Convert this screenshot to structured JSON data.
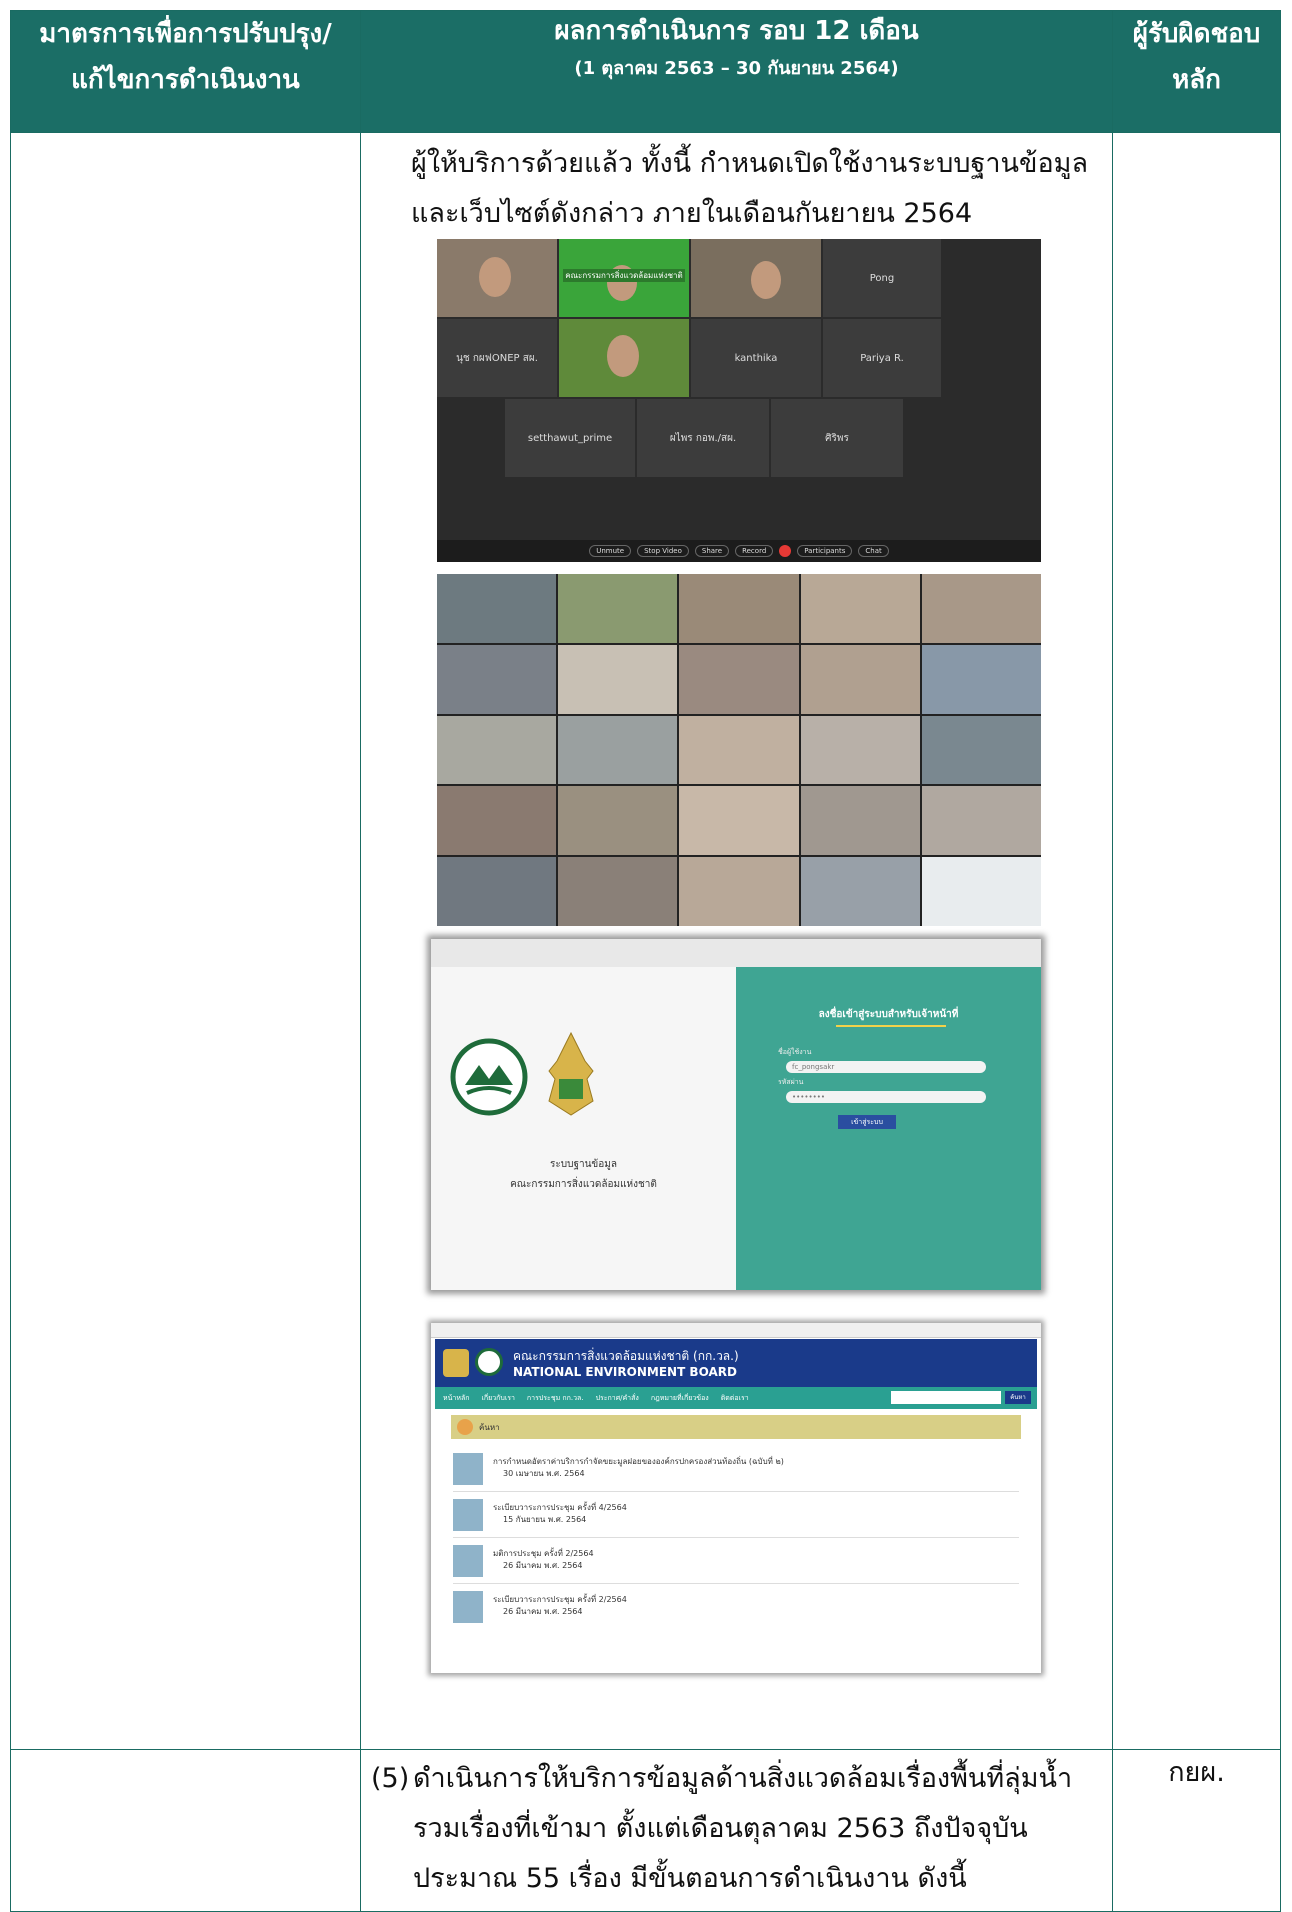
{
  "header": {
    "col1_line1": "มาตรการเพื่อการปรับปรุง/",
    "col1_line2": "แก้ไขการดำเนินงาน",
    "col2_line1": "ผลการดำเนินการ รอบ 12 เดือน",
    "col2_line2": "(1 ตุลาคม 2563 – 30 กันยายน 2564)",
    "col3_line1": "ผู้รับผิดชอบ",
    "col3_line2": "หลัก"
  },
  "row1": {
    "line1": "ผู้ให้บริการด้วยแล้ว  ทั้งนี้ กำหนดเปิดใช้งานระบบฐานข้อมูล",
    "line2": "และเว็บไซต์ดังกล่าว ภายในเดือนกันยายน 2564"
  },
  "photo1": {
    "tiles": [
      "Pong",
      "นุช กผฟONEP สผ.",
      "kanthika",
      "Pariya R.",
      "setthawut_prime",
      "ผไพร กอพ./สผ.",
      "ศิริพร"
    ],
    "banner": "คณะกรรมการสิ่งแวดล้อมแห่งชาติ",
    "controls": [
      "Unmute",
      "Stop Video",
      "Share",
      "Record",
      "Participants",
      "Chat"
    ]
  },
  "photo3": {
    "heading": "ลงชื่อเข้าสู่ระบบสำหรับเจ้าหน้าที่",
    "user_label": "ชื่อผู้ใช้งาน",
    "user_value": "fc_pongsakr",
    "pass_label": "รหัสผ่าน",
    "pass_value": "••••••••",
    "button": "เข้าสู่ระบบ",
    "caption1": "ระบบฐานข้อมูล",
    "caption2": "คณะกรรมการสิ่งแวดล้อมแห่งชาติ"
  },
  "photo4": {
    "title_th": "คณะกรรมการสิ่งแวดล้อมแห่งชาติ (กก.วล.)",
    "title_en": "NATIONAL ENVIRONMENT BOARD",
    "nav": [
      "หน้าหลัก",
      "เกี่ยวกับเรา",
      "การประชุม กก.วล.",
      "ประกาศ/คำสั่ง",
      "กฎหมายที่เกี่ยวข้อง",
      "ติดต่อเรา"
    ],
    "search_button": "ค้นหา",
    "bar_label": "ค้นหา",
    "items": [
      {
        "title": "การกำหนดอัตราค่าบริการกำจัดขยะมูลฝอยขององค์กรปกครองส่วนท้องถิ่น (ฉบับที่ ๒)",
        "date": "30 เมษายน พ.ศ. 2564"
      },
      {
        "title": "ระเบียบวาระการประชุม ครั้งที่ 4/2564",
        "date": "15 กันยายน พ.ศ. 2564"
      },
      {
        "title": "มติการประชุม ครั้งที่ 2/2564",
        "date": "26 มีนาคม พ.ศ. 2564"
      },
      {
        "title": "ระเบียบวาระการประชุม ครั้งที่ 2/2564",
        "date": "26 มีนาคม พ.ศ. 2564"
      }
    ]
  },
  "row2": {
    "num": "(5)",
    "line1": "ดำเนินการให้บริการข้อมูลด้านสิ่งแวดล้อมเรื่องพื้นที่ลุ่มน้ำ",
    "line2": "รวมเรื่องที่เข้ามา ตั้งแต่เดือนตุลาคม 2563 ถึงปัจจุบัน",
    "line3": "ประมาณ 55 เรื่อง มีขั้นตอนการดำเนินงาน ดังนี้",
    "responsible": "กยผ."
  },
  "colors": {
    "header_bg": "#1b6e66",
    "border": "#1a6b62"
  }
}
